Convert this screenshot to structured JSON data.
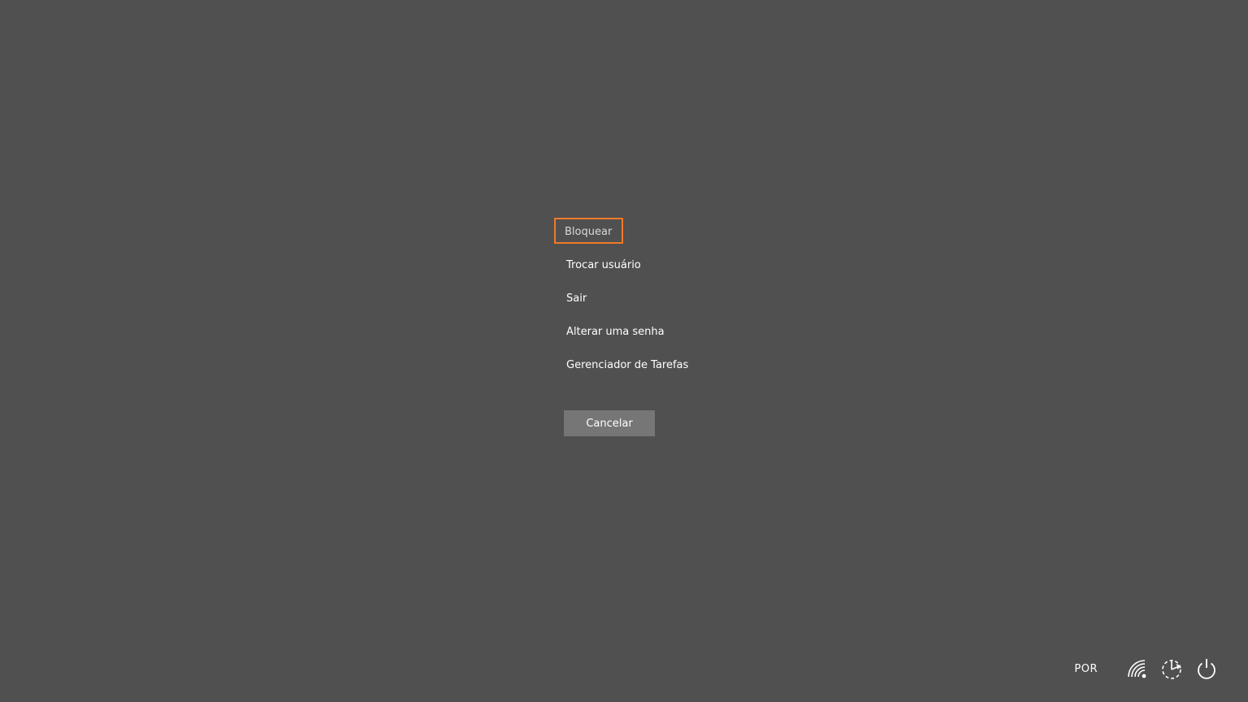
{
  "menu": {
    "items": [
      {
        "label": "Bloquear",
        "focused": true
      },
      {
        "label": "Trocar usuário",
        "focused": false
      },
      {
        "label": "Sair",
        "focused": false
      },
      {
        "label": "Alterar uma senha",
        "focused": false
      },
      {
        "label": "Gerenciador de Tarefas",
        "focused": false
      }
    ]
  },
  "cancel": {
    "label": "Cancelar"
  },
  "tray": {
    "language": "POR",
    "icons": [
      "network-wifi-icon",
      "accessibility-icon",
      "power-icon"
    ]
  },
  "colors": {
    "background": "#505050",
    "focus_outline": "#f07a26",
    "button": "#767676",
    "text": "#ffffff"
  }
}
